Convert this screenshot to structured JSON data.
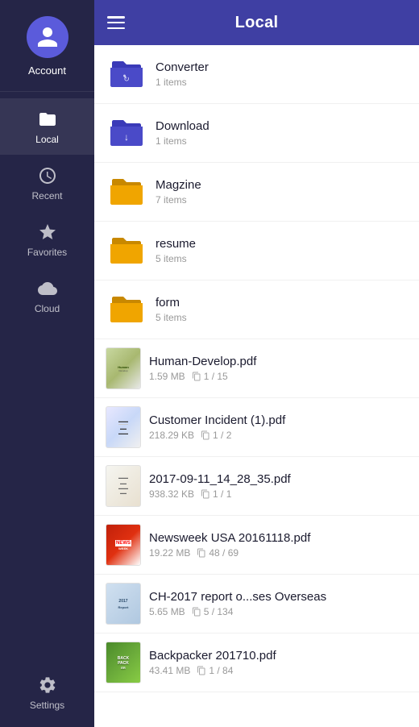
{
  "sidebar": {
    "account_label": "Account",
    "nav_items": [
      {
        "id": "local",
        "label": "Local",
        "active": true
      },
      {
        "id": "recent",
        "label": "Recent",
        "active": false
      },
      {
        "id": "favorites",
        "label": "Favorites",
        "active": false
      },
      {
        "id": "cloud",
        "label": "Cloud",
        "active": false
      }
    ],
    "settings_label": "Settings"
  },
  "header": {
    "title": "Local",
    "hamburger_label": "Menu"
  },
  "files": [
    {
      "type": "folder",
      "color": "blue",
      "name": "Converter",
      "meta": "1 items",
      "pages": null
    },
    {
      "type": "folder",
      "color": "blue",
      "name": "Download",
      "meta": "1 items",
      "pages": null
    },
    {
      "type": "folder",
      "color": "yellow",
      "name": "Magzine",
      "meta": "7 items",
      "pages": null
    },
    {
      "type": "folder",
      "color": "yellow",
      "name": "resume",
      "meta": "5 items",
      "pages": null
    },
    {
      "type": "folder",
      "color": "yellow",
      "name": "form",
      "meta": "5 items",
      "pages": null
    },
    {
      "type": "pdf",
      "thumb": "human",
      "name": "Human-Develop.pdf",
      "meta": "1.59 MB",
      "pages": "1 / 15"
    },
    {
      "type": "pdf",
      "thumb": "customer",
      "name": "Customer Incident (1).pdf",
      "meta": "218.29 KB",
      "pages": "1 / 2"
    },
    {
      "type": "pdf",
      "thumb": "doc2017",
      "name": "2017-09-11_14_28_35.pdf",
      "meta": "938.32 KB",
      "pages": "1 / 1"
    },
    {
      "type": "pdf",
      "thumb": "newsweek",
      "name": "Newsweek USA 20161118.pdf",
      "meta": "19.22 MB",
      "pages": "48 / 69"
    },
    {
      "type": "pdf",
      "thumb": "ch2017",
      "name": "CH-2017 report o...ses Overseas",
      "meta": "5.65 MB",
      "pages": "5 / 134"
    },
    {
      "type": "pdf",
      "thumb": "backpacker",
      "name": "Backpacker 201710.pdf",
      "meta": "43.41 MB",
      "pages": "1 / 84"
    }
  ]
}
